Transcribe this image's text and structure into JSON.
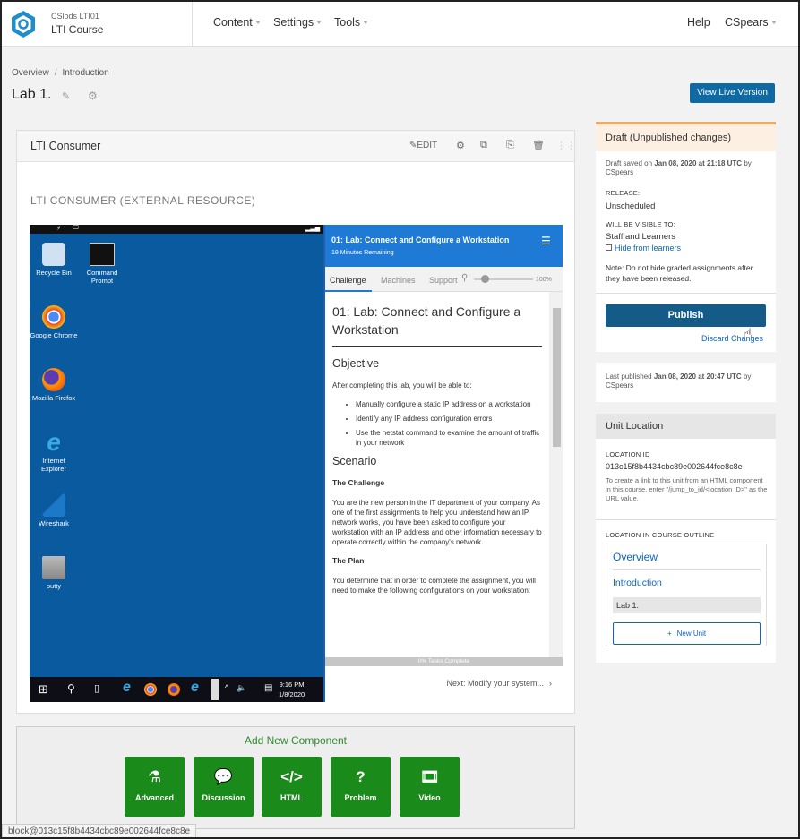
{
  "header": {
    "org": "CSlods  LTI01",
    "course": "LTI Course",
    "nav": [
      "Content",
      "Settings",
      "Tools"
    ],
    "help": "Help",
    "user": "CSpears"
  },
  "breadcrumb": {
    "items": [
      "Overview",
      "Introduction"
    ]
  },
  "page": {
    "title": "Lab 1.",
    "view_live": "View Live Version"
  },
  "component": {
    "title": "LTI Consumer",
    "edit": "EDIT",
    "heading": "LTI CONSUMER (EXTERNAL RESOURCE)"
  },
  "lab": {
    "desktop_icons": [
      {
        "label": "Recycle Bin",
        "icon": "recycle-bin-icon"
      },
      {
        "label": "Command Prompt",
        "icon": "command-prompt-icon"
      },
      {
        "label": "Google Chrome",
        "icon": "chrome-icon"
      },
      {
        "label": "Mozilla Firefox",
        "icon": "firefox-icon"
      },
      {
        "label": "Internet Explorer",
        "icon": "ie-icon"
      },
      {
        "label": "Wireshark",
        "icon": "wireshark-icon"
      },
      {
        "label": "putty",
        "icon": "putty-icon"
      }
    ],
    "time": "9:16 PM",
    "date": "1/8/2020",
    "panel_title": "01: Lab: Connect and Configure a Workstation",
    "remaining": "19 Minutes Remaining",
    "tabs": [
      "Challenge",
      "Machines",
      "Support"
    ],
    "zoom": "100%",
    "content": {
      "h1": "01: Lab: Connect and Configure a Workstation",
      "objective": "Objective",
      "intro": "After completing this lab, you will be able to:",
      "bullets": [
        "Manually configure a static IP address on a workstation",
        "Identify any IP address configuration errors",
        "Use the netstat command to examine the amount of traffic in your network"
      ],
      "scenario": "Scenario",
      "challenge_h": "The Challenge",
      "challenge_p": "You are the new person in the IT department of your company. As one of the first assignments to help you understand how an IP network works, you have been asked to configure your workstation with an IP address and other information necessary to operate correctly within the company's network.",
      "plan_h": "The Plan",
      "plan_p": "You determine that in order to complete the assignment, you will need to make the following configurations on your workstation:"
    },
    "progress": "0% Tasks Complete",
    "next": "Next: Modify your system..."
  },
  "add_component": {
    "title": "Add New Component",
    "buttons": [
      "Advanced",
      "Discussion",
      "HTML",
      "Problem",
      "Video"
    ]
  },
  "publish": {
    "state": "Draft (Unpublished changes)",
    "draft_prefix": "Draft saved on ",
    "draft_date": "Jan 08, 2020 at 21:18 UTC",
    "by": " by",
    "draft_user": "CSpears",
    "release_label": "RELEASE:",
    "release_value": "Unscheduled",
    "visible_label": "WILL BE VISIBLE TO:",
    "visible_value": "Staff and Learners",
    "hide": "Hide from learners",
    "note": "Note: Do not hide graded assignments after they have been released.",
    "publish_btn": "Publish",
    "discard": "Discard Changes"
  },
  "last_published": {
    "prefix": "Last published ",
    "date": "Jan 08, 2020 at 20:47 UTC",
    "by": " by",
    "user": "CSpears"
  },
  "unit_location": {
    "title": "Unit Location",
    "id_label": "LOCATION ID",
    "id": "013c15f8b4434cbc89e002644fce8c8e",
    "help": "To create a link to this unit from an HTML component in this course, enter \"/jump_to_id/<location ID>\" as the URL value.",
    "outline_label": "LOCATION IN COURSE OUTLINE",
    "section": "Overview",
    "subsection": "Introduction",
    "unit": "Lab 1.",
    "new_unit": "New Unit"
  },
  "status_bar": "block@013c15f8b4434cbc89e002644fce8c8e",
  "colors": {
    "primary": "#0f6aa3",
    "publish": "#145b87",
    "green": "#1a8b1a",
    "draft_accent": "#f0a95e",
    "lab_blue": "#1f7ad6"
  }
}
